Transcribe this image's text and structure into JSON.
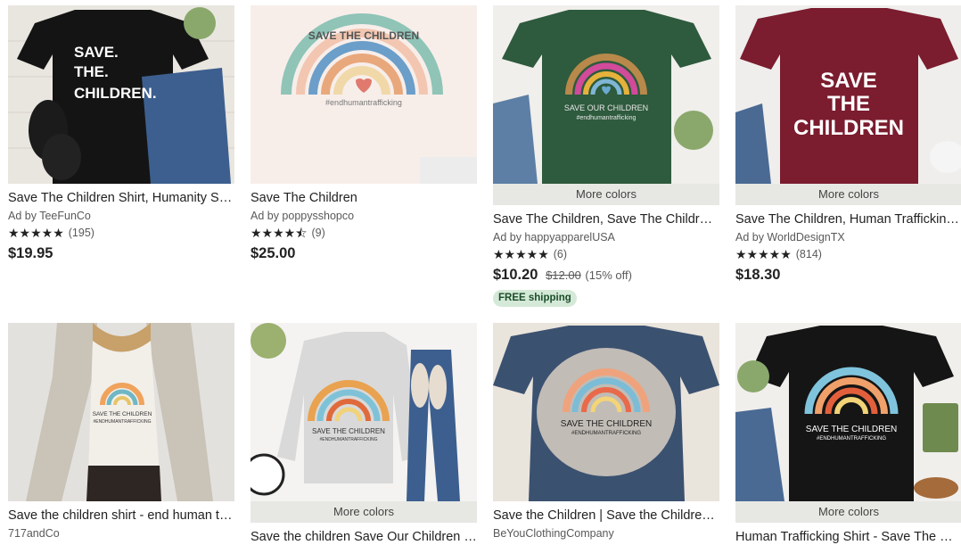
{
  "listings": [
    {
      "title": "Save The Children Shirt, Humanity Shirt, Protect Our Kids",
      "seller": "Ad by TeeFunCo",
      "stars": "★★★★★",
      "count": "(195)",
      "price": "$19.95",
      "shirt_text": [
        "SAVE.",
        "THE.",
        "CHILDREN."
      ],
      "shirt_color": "#141414"
    },
    {
      "title": "Save The Children",
      "seller": "Ad by poppysshopco",
      "stars": "★★★★⯪",
      "count": "(9)",
      "price": "$25.00",
      "shirt_text": [
        "SAVE THE CHILDREN",
        "#endhumantrafficking"
      ],
      "shirt_color": "#f7eeea"
    },
    {
      "title": "Save The Children, Save The Children Shirt",
      "seller": "Ad by happyapparelUSA",
      "stars": "★★★★★",
      "count": "(6)",
      "price": "$10.20",
      "orig_price": "$12.00",
      "discount": "(15% off)",
      "badge": "FREE shipping",
      "more": "More colors",
      "shirt_text": [
        "SAVE OUR CHILDREN",
        "#endhumantrafficking"
      ],
      "shirt_color": "#2e5a3d"
    },
    {
      "title": "Save The Children, Human Trafficking Awareness",
      "seller": "Ad by WorldDesignTX",
      "stars": "★★★★★",
      "count": "(814)",
      "price": "$18.30",
      "more": "More colors",
      "shirt_text": [
        "SAVE",
        "THE",
        "CHILDREN"
      ],
      "shirt_color": "#7b1c2f"
    },
    {
      "title": "Save the children shirt - end human trafficking",
      "seller": "717andCo",
      "shirt_text": [
        "SAVE THE CHILDREN",
        "#ENDHUMANTRAFFICKING"
      ],
      "shirt_color": "#f2efe9"
    },
    {
      "title": "Save the children Save Our Children Sweatshirt",
      "more": "More colors",
      "shirt_text": [
        "SAVE THE CHILDREN",
        "#ENDHUMANTRAFFICKING"
      ],
      "shirt_color": "#d9d9d9"
    },
    {
      "title": "Save the Children | Save the Children Shirt",
      "seller": "BeYouClothingCompany",
      "shirt_text": [
        "SAVE THE CHILDREN",
        "#ENDHUMANTRAFFICKING"
      ],
      "shirt_color": "#3b5170"
    },
    {
      "title": "Human Trafficking Shirt - Save The Children",
      "more": "More colors",
      "shirt_text": [
        "SAVE THE CHILDREN",
        "#ENDHUMANTRAFFICKING"
      ],
      "shirt_color": "#151515"
    }
  ]
}
